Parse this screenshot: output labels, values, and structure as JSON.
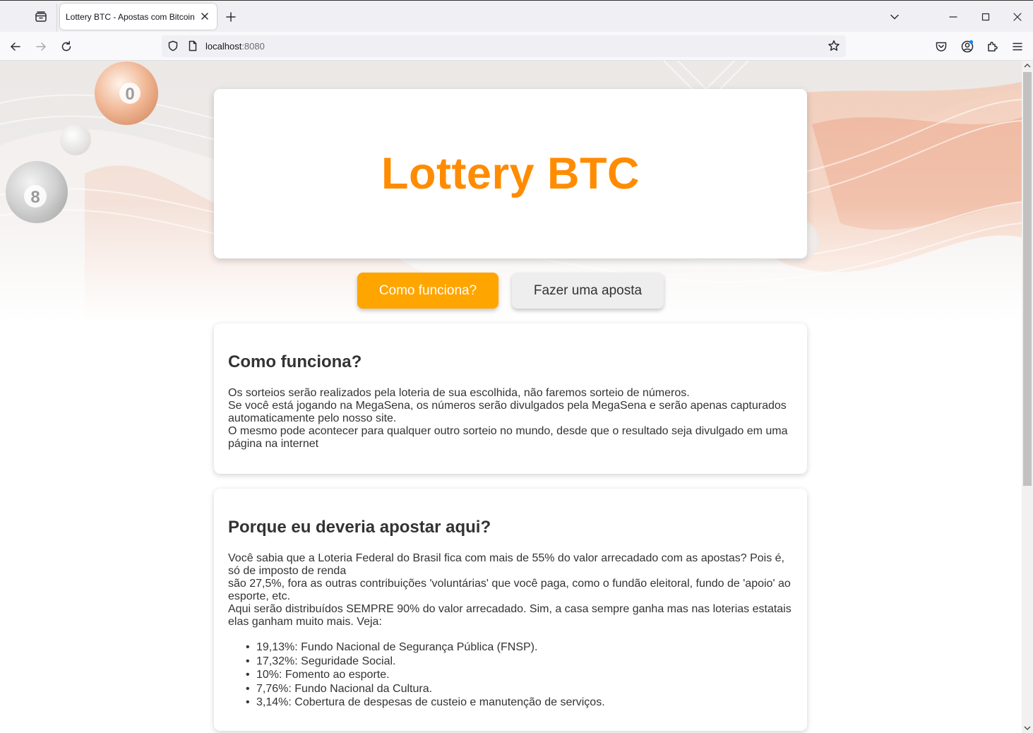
{
  "browser": {
    "tab_title": "Lottery BTC - Apostas com Bitcoin",
    "url_host": "localhost",
    "url_port": ":8080",
    "icons": {
      "tab_list": "tab-list-icon",
      "close_tab": "close-icon",
      "new_tab": "plus-icon",
      "tabs_menu": "chevron-down-icon",
      "minimize": "minimize-icon",
      "maximize": "maximize-icon",
      "close_window": "close-icon",
      "back": "back-arrow-icon",
      "forward": "forward-arrow-icon",
      "reload": "reload-icon",
      "shield": "shield-icon",
      "page": "page-icon",
      "bookmark": "star-icon",
      "pocket": "pocket-icon",
      "account": "account-icon",
      "extensions": "puzzle-icon",
      "menu": "hamburger-menu-icon"
    }
  },
  "page": {
    "title": "Lottery BTC",
    "accent_color": "#ff8c00",
    "buttons": {
      "how_it_works": "Como funciona?",
      "place_bet": "Fazer uma aposta"
    },
    "how_it_works": {
      "heading": "Como funciona?",
      "lines": [
        "Os sorteios serão realizados pela loteria de sua escolhida, não faremos sorteio de números.",
        "Se você está jogando na MegaSena, os números serão divulgados pela MegaSena e serão apenas capturados automaticamente pelo nosso site.",
        "O mesmo pode acontecer para qualquer outro sorteio no mundo, desde que o resultado seja divulgado em uma página na internet"
      ]
    },
    "why_bet_here": {
      "heading": "Porque eu deveria apostar aqui?",
      "lines": [
        "Você sabia que a Loteria Federal do Brasil fica com mais de 55% do valor arrecadado com as apostas? Pois é, só de imposto de renda",
        "são 27,5%, fora as outras contribuições 'voluntárias' que você paga, como o fundão eleitoral, fundo de 'apoio' ao esporte, etc.",
        "Aqui serão distribuídos SEMPRE 90% do valor arrecadado. Sim, a casa sempre ganha mas nas loterias estatais elas ganham muito mais. Veja:"
      ],
      "items": [
        "19,13%: Fundo Nacional de Segurança Pública (FNSP).",
        "17,32%: Seguridade Social.",
        "10%: Fomento ao esporte.",
        "7,76%: Fundo Nacional da Cultura.",
        "3,14%: Cobertura de despesas de custeio e manutenção de serviços."
      ]
    }
  }
}
